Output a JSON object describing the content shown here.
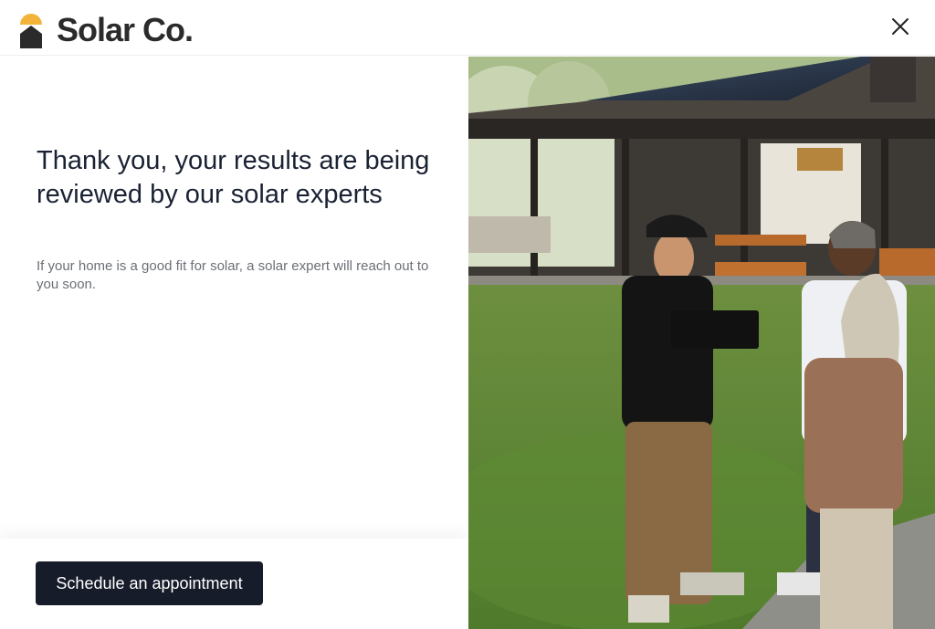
{
  "header": {
    "brand": "Solar Co.",
    "logo_icon": "house-sun-logo",
    "close_icon": "close-icon"
  },
  "content": {
    "headline": "Thank you, your results are being reviewed by our solar experts",
    "subtext": "If your home is a good fit for solar, a solar expert will reach out to you soon."
  },
  "footer": {
    "cta_label": "Schedule an appointment"
  },
  "colors": {
    "brand_yellow": "#f2b43a",
    "brand_dark": "#2b2b2b",
    "button_bg": "#161c2a"
  }
}
